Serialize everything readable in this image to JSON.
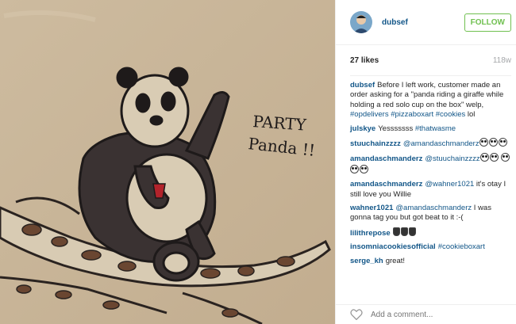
{
  "post": {
    "photo_text": [
      "PARTY",
      "Panda !!"
    ],
    "author": "dubsef",
    "follow_label": "FOLLOW",
    "likes": "27 likes",
    "time_ago": "118w",
    "caption": {
      "user": "dubsef",
      "text": "Before I left work, customer made an order asking for a \"panda riding a giraffe while holding a red solo cup on the box\" welp,",
      "tags": [
        "#opdelivers",
        "#pizzaboxart",
        "#cookies"
      ],
      "tail": "lol"
    },
    "comments": [
      {
        "user": "julskye",
        "parts": [
          {
            "t": "text",
            "v": "Yesssssss "
          },
          {
            "t": "tag",
            "v": "#thatwasme"
          }
        ]
      },
      {
        "user": "stuuchainzzzz",
        "parts": [
          {
            "t": "mention",
            "v": "@amandaschmanderz"
          },
          {
            "t": "emoji",
            "v": "panda"
          },
          {
            "t": "emoji",
            "v": "panda"
          },
          {
            "t": "emoji",
            "v": "panda"
          }
        ]
      },
      {
        "user": "amandaschmanderz",
        "parts": [
          {
            "t": "mention",
            "v": "@stuuchainzzzz"
          },
          {
            "t": "emoji",
            "v": "panda"
          },
          {
            "t": "emoji",
            "v": "panda"
          },
          {
            "t": "text",
            "v": " "
          },
          {
            "t": "emoji",
            "v": "panda"
          },
          {
            "t": "emoji",
            "v": "panda"
          },
          {
            "t": "emoji",
            "v": "panda"
          }
        ]
      },
      {
        "user": "amandaschmanderz",
        "parts": [
          {
            "t": "mention",
            "v": "@wahner1021"
          },
          {
            "t": "text",
            "v": " it's otay I still love you Willie"
          }
        ]
      },
      {
        "user": "wahner1021",
        "parts": [
          {
            "t": "mention",
            "v": "@amandaschmanderz"
          },
          {
            "t": "text",
            "v": " I was gonna tag you but got beat to it :-("
          }
        ]
      },
      {
        "user": "lilithrepose",
        "parts": [
          {
            "t": "emoji",
            "v": "hand"
          },
          {
            "t": "emoji",
            "v": "hand"
          },
          {
            "t": "emoji",
            "v": "hand"
          }
        ]
      },
      {
        "user": "insomniacookiesofficial",
        "parts": [
          {
            "t": "tag",
            "v": "#cookieboxart"
          }
        ]
      },
      {
        "user": "serge_kh",
        "parts": [
          {
            "t": "text",
            "v": "great!"
          }
        ]
      }
    ],
    "add_comment_placeholder": "Add a comment...",
    "colors": {
      "link": "#125688",
      "follow": "#70c050",
      "muted": "#a5a7aa"
    }
  }
}
